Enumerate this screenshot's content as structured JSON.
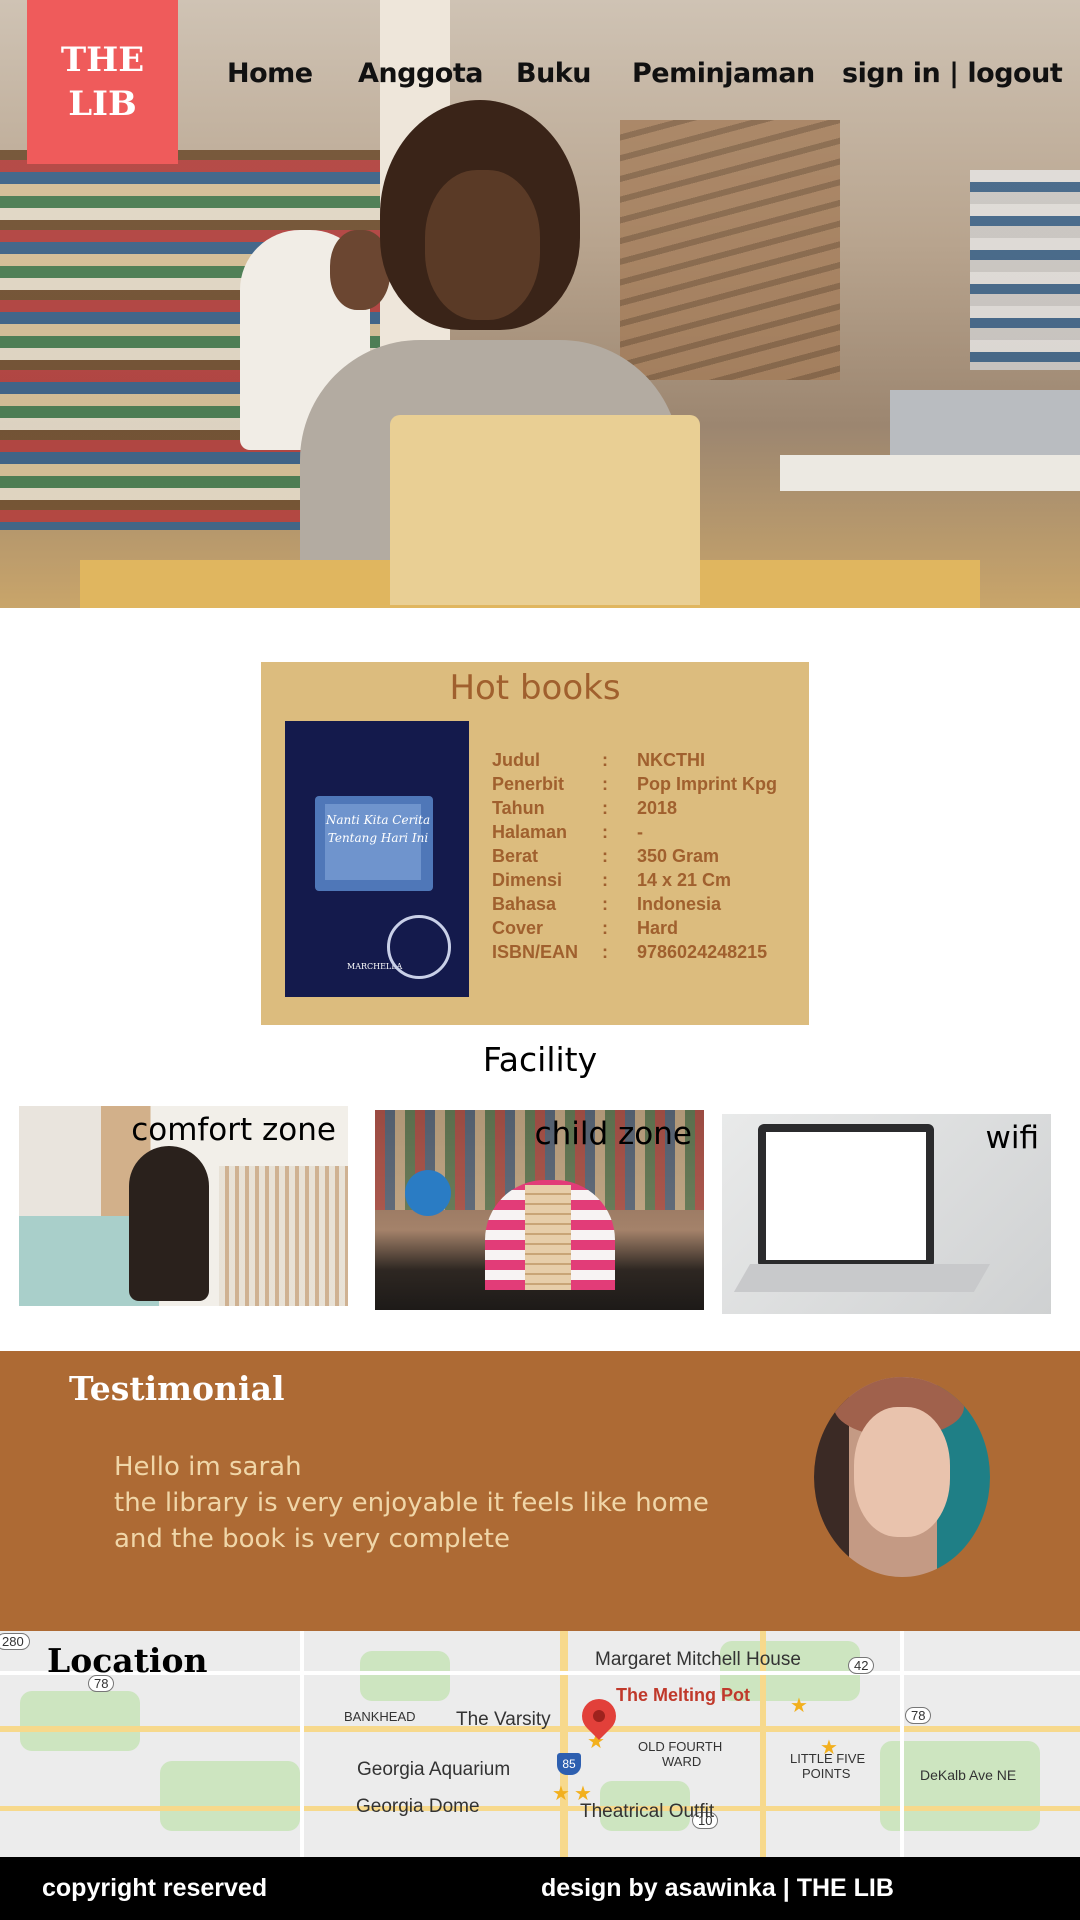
{
  "brand": {
    "logo_line1": "THE",
    "logo_line2": "LIB"
  },
  "nav": {
    "home": "Home",
    "anggota": "Anggota",
    "buku": "Buku",
    "peminjaman": "Peminjaman",
    "sign": "sign in | logout"
  },
  "hot_books": {
    "title": "Hot books",
    "cover": {
      "title_text": "Nanti Kita Cerita Tentang Hari Ini",
      "author": "MARCHELLA"
    },
    "specs": [
      {
        "key": "Judul",
        "sep": ":",
        "value": "NKCTHI"
      },
      {
        "key": "Penerbit",
        "sep": ":",
        "value": "Pop Imprint Kpg"
      },
      {
        "key": "Tahun",
        "sep": ":",
        "value": "2018"
      },
      {
        "key": "Halaman",
        "sep": ":",
        "value": "-"
      },
      {
        "key": "Berat",
        "sep": ":",
        "value": "350 Gram"
      },
      {
        "key": "Dimensi",
        "sep": ":",
        "value": "14 x 21 Cm"
      },
      {
        "key": "Bahasa",
        "sep": ":",
        "value": "Indonesia"
      },
      {
        "key": "Cover",
        "sep": ":",
        "value": "Hard"
      },
      {
        "key": "ISBN/EAN",
        "sep": ":",
        "value": "9786024248215"
      }
    ]
  },
  "facility": {
    "title": "Facility",
    "items": [
      {
        "label": "comfort zone"
      },
      {
        "label": "child zone"
      },
      {
        "label": "wifi"
      }
    ]
  },
  "testimonial": {
    "title": "Testimonial",
    "lines": [
      "Hello im sarah",
      "the library is very enjoyable it feels like home",
      "and the book is very complete"
    ]
  },
  "location": {
    "title": "Location",
    "places": {
      "margaret": "Margaret Mitchell House",
      "melting": "The Melting Pot",
      "bankhead": "BANKHEAD",
      "varsity": "The Varsity",
      "old_fourth": "OLD FOURTH",
      "ward": "WARD",
      "little_five": "LITTLE FIVE",
      "points": "POINTS",
      "aquarium": "Georgia Aquarium",
      "dome": "Georgia Dome",
      "theatrical": "Theatrical Outfit",
      "dekalb": "DeKalb Ave NE"
    },
    "highways": {
      "h280": "280",
      "h78a": "78",
      "h42": "42",
      "h78b": "78",
      "h85": "85",
      "h10": "10"
    }
  },
  "footer": {
    "left": "copyright reserved",
    "right": "design by asawinka | THE LIB"
  },
  "colors": {
    "logo": "#ef5b5b",
    "hot_books_bg": "#dcbc7e",
    "hot_books_text": "#a0602e",
    "testimonial_bg": "#ad6a34",
    "testimonial_text": "#f0d6a8",
    "footer_bg": "#000000"
  }
}
